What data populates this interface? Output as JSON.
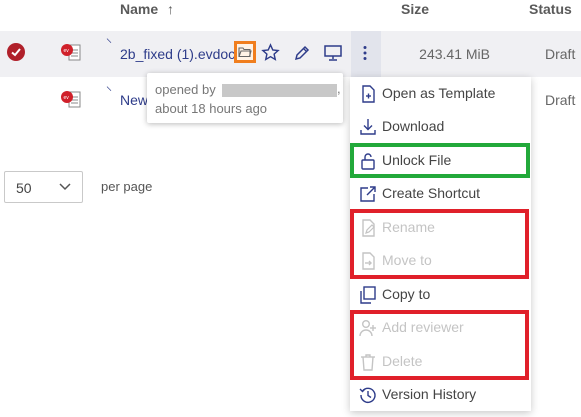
{
  "table": {
    "headers": {
      "name": "Name",
      "size": "Size",
      "status": "Status"
    },
    "sort_arrow": "↑",
    "rows": [
      {
        "name": "2b_fixed (1).evdoc",
        "size": "243.41 MiB",
        "status": "Draft"
      },
      {
        "name": "New",
        "size": "",
        "status": "Draft"
      }
    ]
  },
  "tooltip": {
    "line1": "opened by",
    "line2": "about 18 hours ago",
    "trailing": ","
  },
  "pager": {
    "page_size": "50",
    "per_page_label": "per page"
  },
  "menu": {
    "items": [
      {
        "label": "Open as Template",
        "icon": "template-icon",
        "enabled": true
      },
      {
        "label": "Download",
        "icon": "download-icon",
        "enabled": true
      },
      {
        "label": "Unlock File",
        "icon": "unlock-icon",
        "enabled": true
      },
      {
        "label": "Create Shortcut",
        "icon": "shortcut-icon",
        "enabled": true
      },
      {
        "label": "Rename",
        "icon": "rename-icon",
        "enabled": false
      },
      {
        "label": "Move to",
        "icon": "move-icon",
        "enabled": false
      },
      {
        "label": "Copy to",
        "icon": "copy-icon",
        "enabled": true
      },
      {
        "label": "Add reviewer",
        "icon": "add-reviewer-icon",
        "enabled": false
      },
      {
        "label": "Delete",
        "icon": "trash-icon",
        "enabled": false
      },
      {
        "label": "Version History",
        "icon": "history-icon",
        "enabled": true
      }
    ]
  },
  "colors": {
    "highlight_orange": "#f07e1e",
    "highlight_green": "#22a93a",
    "highlight_red": "#e0202a",
    "link_blue": "#2e3c8a",
    "selected_check": "#b0202a"
  }
}
